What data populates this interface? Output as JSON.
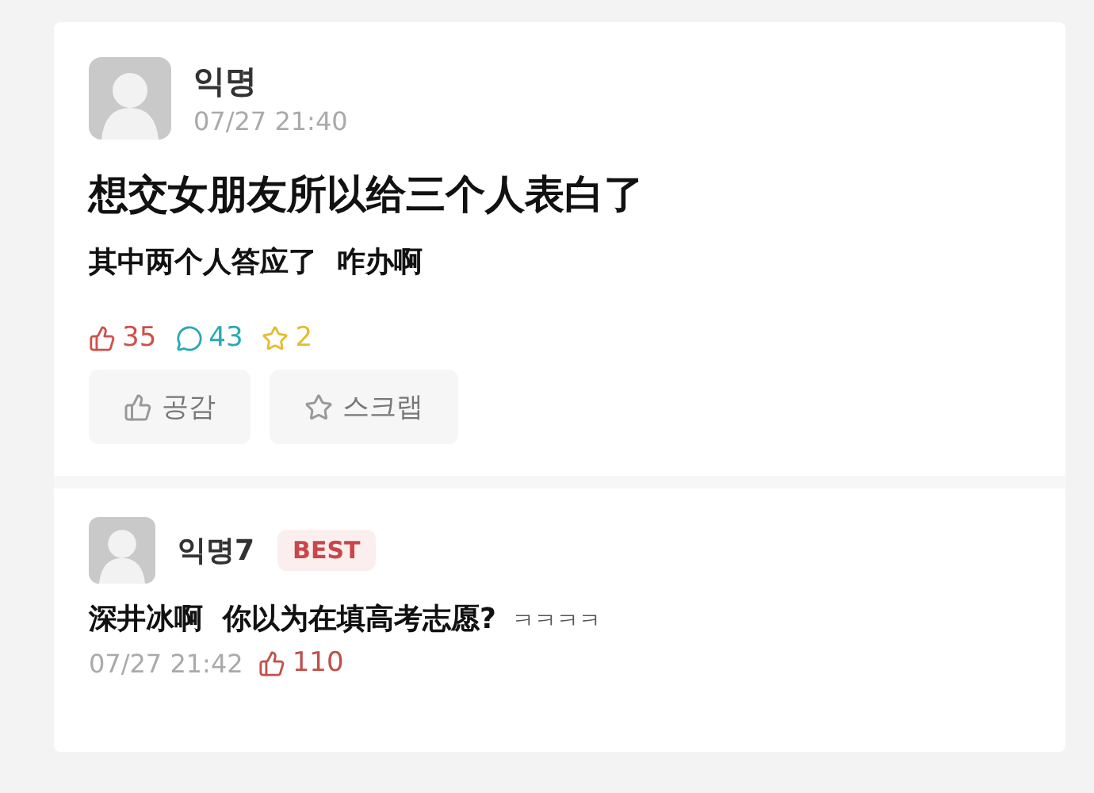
{
  "post": {
    "author": "익명",
    "time": "07/27 21:40",
    "title": "想交女朋友所以给三个人表白了",
    "body": "其中两个人答应了  咋办啊",
    "stats": {
      "likes": "35",
      "comments": "43",
      "scraps": "2"
    },
    "buttons": [
      {
        "kind": "like",
        "label": "공감"
      },
      {
        "kind": "scrap",
        "label": "스크랩"
      }
    ]
  },
  "comments": [
    {
      "author": "익명7",
      "badge": "BEST",
      "text": "深井冰啊  你以为在填高考志愿?",
      "suffix": "ㅋㅋㅋㅋ",
      "time": "07/27 21:42",
      "likes": "110"
    }
  ]
}
